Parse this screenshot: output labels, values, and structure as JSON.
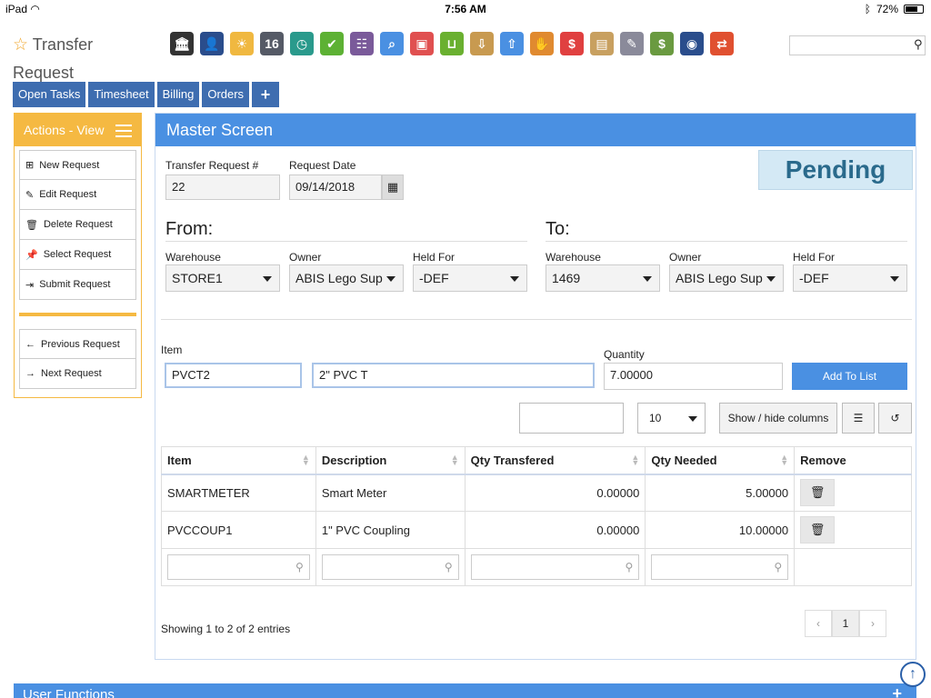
{
  "status_bar": {
    "device": "iPad",
    "time": "7:56 AM",
    "battery": "72%",
    "battery_level": 0.72
  },
  "header": {
    "title": "Transfer Request",
    "search_placeholder": ""
  },
  "toolbar": [
    {
      "icon": "bank-icon",
      "color": "#333333",
      "glyph": "🏛"
    },
    {
      "icon": "user-icon",
      "color": "#2a4d8c",
      "glyph": "👤"
    },
    {
      "icon": "weather-icon",
      "color": "#f0b840",
      "glyph": "☀"
    },
    {
      "icon": "calendar-icon",
      "color": "#555a66",
      "glyph": "16"
    },
    {
      "icon": "clock-icon",
      "color": "#2a9a8c",
      "glyph": "◷"
    },
    {
      "icon": "check-icon",
      "color": "#5db134",
      "glyph": "✔"
    },
    {
      "icon": "abacus-icon",
      "color": "#7a5a9a",
      "glyph": "☷"
    },
    {
      "icon": "magnifier-icon",
      "color": "#4a90e2",
      "glyph": "⌕"
    },
    {
      "icon": "bus-icon",
      "color": "#e05050",
      "glyph": "▣"
    },
    {
      "icon": "basket-icon",
      "color": "#6ab030",
      "glyph": "⊔"
    },
    {
      "icon": "box-download-icon",
      "color": "#c89a50",
      "glyph": "⇩"
    },
    {
      "icon": "box-upload-icon",
      "color": "#4a90e2",
      "glyph": "⇧"
    },
    {
      "icon": "hand-sign-icon",
      "color": "#e08a30",
      "glyph": "✋"
    },
    {
      "icon": "dollar-bubble-icon",
      "color": "#e04040",
      "glyph": "$"
    },
    {
      "icon": "clipboard-icon",
      "color": "#c8a060",
      "glyph": "▤"
    },
    {
      "icon": "pencil-icon",
      "color": "#8a8a9a",
      "glyph": "✎"
    },
    {
      "icon": "cash-icon",
      "color": "#6a9a40",
      "glyph": "$"
    },
    {
      "icon": "book-icon",
      "color": "#2a4d8c",
      "glyph": "◉"
    },
    {
      "icon": "exchange-icon",
      "color": "#e05030",
      "glyph": "⇄"
    }
  ],
  "nav_tabs": [
    "Open Tasks",
    "Timesheet",
    "Billing",
    "Orders",
    "+"
  ],
  "sidebar": {
    "title": "Actions - View",
    "items": [
      {
        "icon": "plus-square-icon",
        "glyph": "⊞",
        "label": "New Request"
      },
      {
        "icon": "pencil-icon",
        "glyph": "✎",
        "label": "Edit Request"
      },
      {
        "icon": "trash-icon",
        "glyph": "🗑",
        "label": "Delete Request"
      },
      {
        "icon": "pin-icon",
        "glyph": "📌",
        "label": "Select Request"
      },
      {
        "icon": "sign-in-icon",
        "glyph": "⇥",
        "label": "Submit Request"
      }
    ],
    "nav_items": [
      {
        "icon": "arrow-left-icon",
        "glyph": "←",
        "label": "Previous Request"
      },
      {
        "icon": "arrow-right-icon",
        "glyph": "→",
        "label": "Next Request"
      }
    ]
  },
  "panel": {
    "title": "Master Screen",
    "status": "Pending",
    "request_no_label": "Transfer Request #",
    "request_no": "22",
    "request_date_label": "Request Date",
    "request_date": "09/14/2018",
    "from": {
      "heading": "From:",
      "warehouse_label": "Warehouse",
      "warehouse": "STORE1",
      "owner_label": "Owner",
      "owner": "ABIS Lego Sup",
      "held_label": "Held For",
      "held": "-DEF"
    },
    "to": {
      "heading": "To:",
      "warehouse_label": "Warehouse",
      "warehouse": "1469",
      "owner_label": "Owner",
      "owner": "ABIS Lego Sup",
      "held_label": "Held For",
      "held": "-DEF"
    },
    "item_label": "Item",
    "item_code": "PVCT2",
    "item_desc": "2\" PVC T",
    "qty_label": "Quantity",
    "qty": "7.00000",
    "add_button": "Add To List",
    "page_size": "10",
    "show_hide": "Show / hide columns"
  },
  "table": {
    "columns": [
      "Item",
      "Description",
      "Qty Transfered",
      "Qty Needed",
      "Remove"
    ],
    "rows": [
      {
        "item": "SMARTMETER",
        "desc": "Smart Meter",
        "qty_t": "0.00000",
        "qty_n": "5.00000"
      },
      {
        "item": "PVCCOUP1",
        "desc": "1\" PVC Coupling",
        "qty_t": "0.00000",
        "qty_n": "10.00000"
      }
    ],
    "showing": "Showing 1 to 2 of 2 entries",
    "pager": {
      "prev": "‹",
      "current": "1",
      "next": "›"
    }
  },
  "footer": {
    "user_functions": "User Functions",
    "plus": "+"
  }
}
